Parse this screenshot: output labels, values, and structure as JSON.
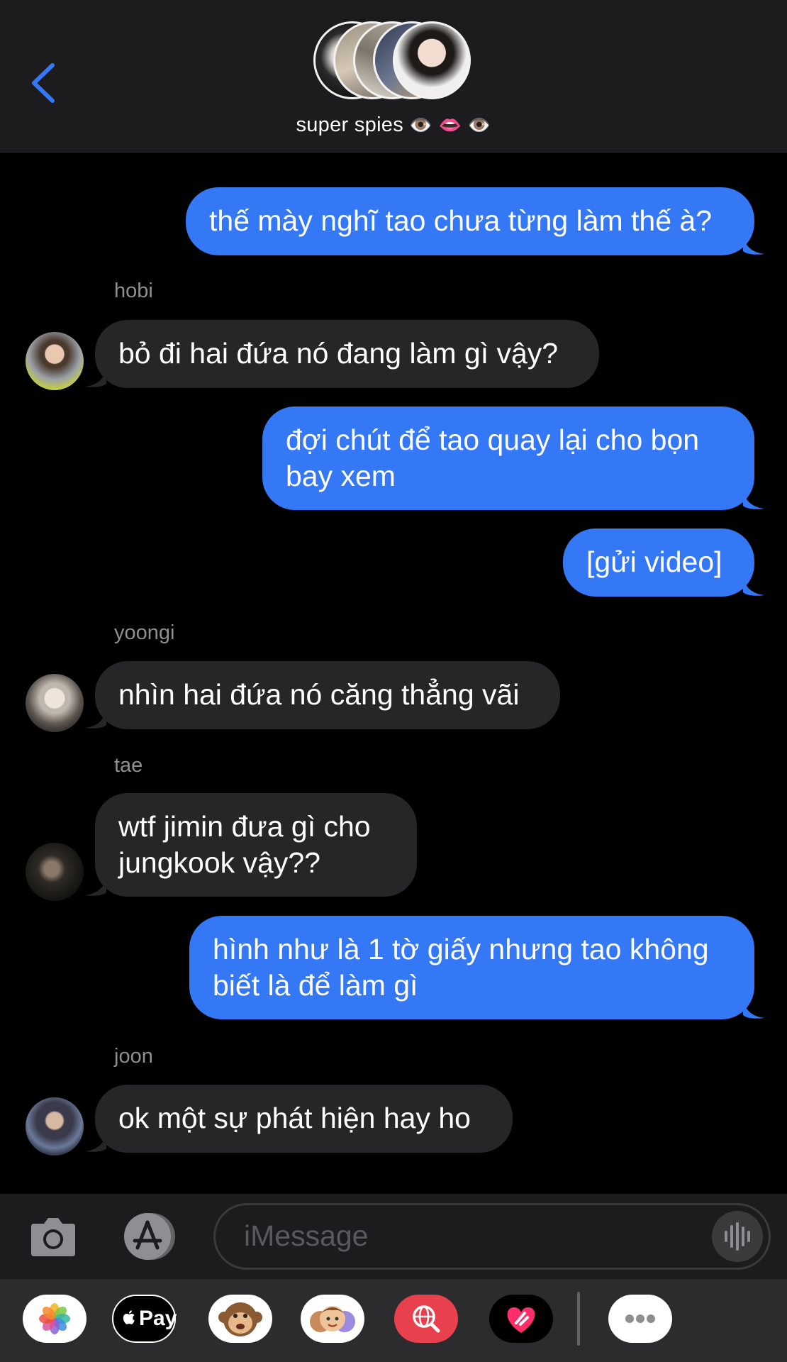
{
  "header": {
    "group_name": "super spies",
    "group_emoji": "👁️ 👄 👁️"
  },
  "messages": [
    {
      "dir": "sent",
      "text": "thế mày nghĩ tao chưa từng làm thế à?"
    },
    {
      "dir": "recv",
      "sender": "hobi",
      "text": "bỏ đi hai đứa nó đang làm gì vậy?"
    },
    {
      "dir": "sent",
      "text": "đợi chút để tao quay lại cho bọn bay xem"
    },
    {
      "dir": "sent",
      "text": "[gửi video]"
    },
    {
      "dir": "recv",
      "sender": "yoongi",
      "text": "nhìn hai đứa nó căng thẳng vãi"
    },
    {
      "dir": "recv",
      "sender": "tae",
      "text": "wtf jimin đưa gì cho jungkook vậy??"
    },
    {
      "dir": "sent",
      "text": "hình như là 1 tờ giấy nhưng tao không biết là để làm gì"
    },
    {
      "dir": "recv",
      "sender": "joon",
      "text": "ok một sự phát hiện hay ho"
    }
  ],
  "input": {
    "placeholder": "iMessage"
  },
  "tray": {
    "applepay_label": "Pay"
  },
  "colors": {
    "sent_bubble": "#3478f6",
    "recv_bubble": "#262629",
    "accent": "#3478f6"
  }
}
